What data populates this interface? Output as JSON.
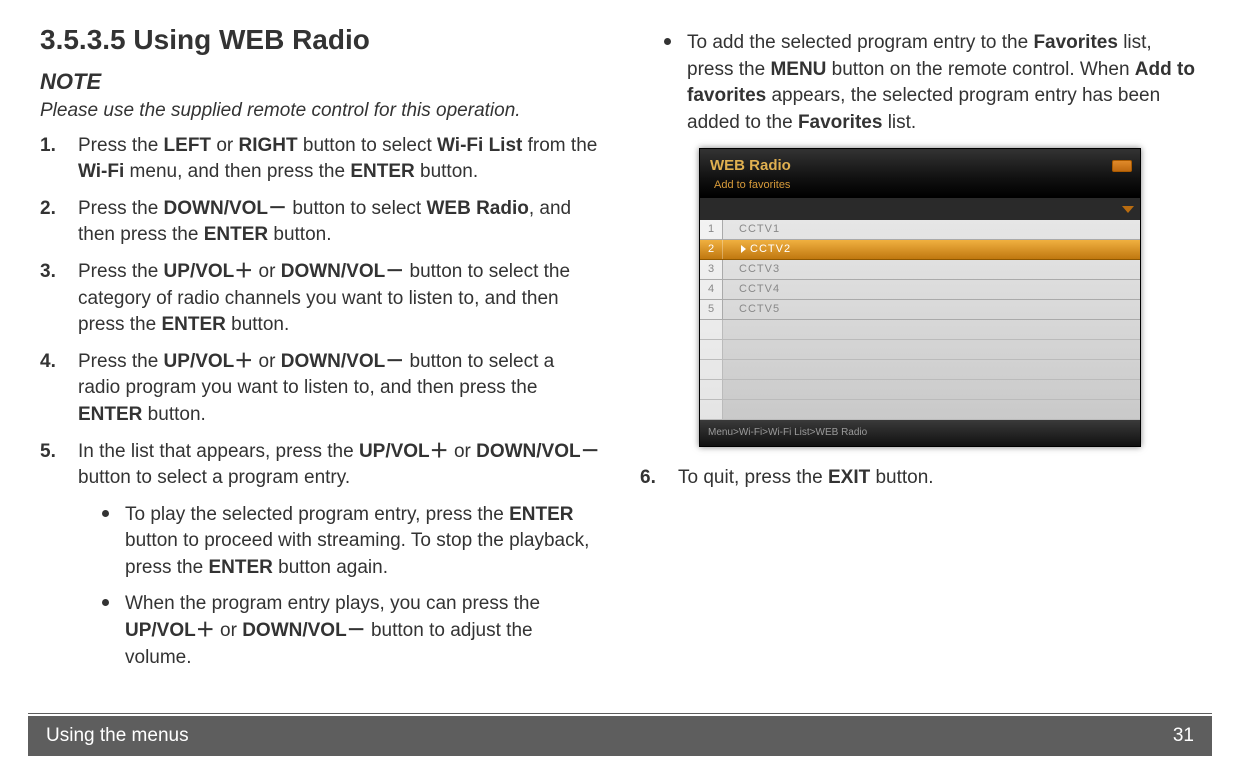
{
  "heading": "3.5.3.5   Using WEB Radio",
  "note": {
    "label": "NOTE",
    "text": "Please use the supplied remote control for this operation."
  },
  "steps_left": [
    {
      "num": "1.",
      "parts": [
        "Press the ",
        {
          "b": "LEFT"
        },
        " or ",
        {
          "b": "RIGHT"
        },
        " button to select ",
        {
          "b": "Wi-Fi List"
        },
        " from the ",
        {
          "b": "Wi-Fi"
        },
        " menu, and then press the ",
        {
          "b": "ENTER"
        },
        " button."
      ]
    },
    {
      "num": "2.",
      "parts": [
        "Press the ",
        {
          "b": "DOWN/VOL－"
        },
        " button to select ",
        {
          "b": "WEB Radio"
        },
        ", and then press the ",
        {
          "b": "ENTER"
        },
        " button."
      ]
    },
    {
      "num": "3.",
      "parts": [
        "Press the ",
        {
          "b": "UP/VOL＋"
        },
        " or ",
        {
          "b": "DOWN/VOL－"
        },
        " button to select the category of radio channels you want to listen to, and then press the ",
        {
          "b": "ENTER"
        },
        " button."
      ]
    },
    {
      "num": "4.",
      "parts": [
        "Press the ",
        {
          "b": "UP/VOL＋"
        },
        " or ",
        {
          "b": "DOWN/VOL－"
        },
        " button to select a radio program you want to listen to, and then press the ",
        {
          "b": "ENTER"
        },
        " button."
      ]
    },
    {
      "num": "5.",
      "parts": [
        "In the list that appears, press the ",
        {
          "b": "UP/VOL＋"
        },
        " or ",
        {
          "b": "DOWN/VOL－"
        },
        " button to select a program entry."
      ],
      "bullets": [
        {
          "parts": [
            "To play the selected program entry, press the ",
            {
              "b": "ENTER"
            },
            " button to proceed with streaming. To stop the playback, press the ",
            {
              "b": "ENTER"
            },
            " button again."
          ]
        },
        {
          "parts": [
            "When the program entry plays, you can press the ",
            {
              "b": "UP/VOL＋"
            },
            " or ",
            {
              "b": "DOWN/VOL－"
            },
            " button to adjust the volume."
          ]
        }
      ]
    }
  ],
  "bullets_right": [
    {
      "parts": [
        "To add the selected program entry to the ",
        {
          "b": "Favorites"
        },
        " list, press the ",
        {
          "b": "MENU"
        },
        " button on the remote control. When ",
        {
          "b": "Add to favorites"
        },
        " appears, the selected program entry has been added to the ",
        {
          "b": "Favorites"
        },
        " list."
      ]
    }
  ],
  "steps_right": [
    {
      "num": "6.",
      "parts": [
        "To quit, press the ",
        {
          "b": "EXIT"
        },
        " button."
      ]
    }
  ],
  "device": {
    "title": "WEB Radio",
    "subtitle": "Add to favorites",
    "rows": [
      {
        "n": "1",
        "label": "CCTV1",
        "sel": false
      },
      {
        "n": "2",
        "label": "CCTV2",
        "sel": true
      },
      {
        "n": "3",
        "label": "CCTV3",
        "sel": false
      },
      {
        "n": "4",
        "label": "CCTV4",
        "sel": false
      },
      {
        "n": "5",
        "label": "CCTV5",
        "sel": false
      }
    ],
    "breadcrumb": "Menu>Wi-Fi>Wi-Fi List>WEB Radio"
  },
  "footer": {
    "section": "Using the menus",
    "page": "31"
  }
}
